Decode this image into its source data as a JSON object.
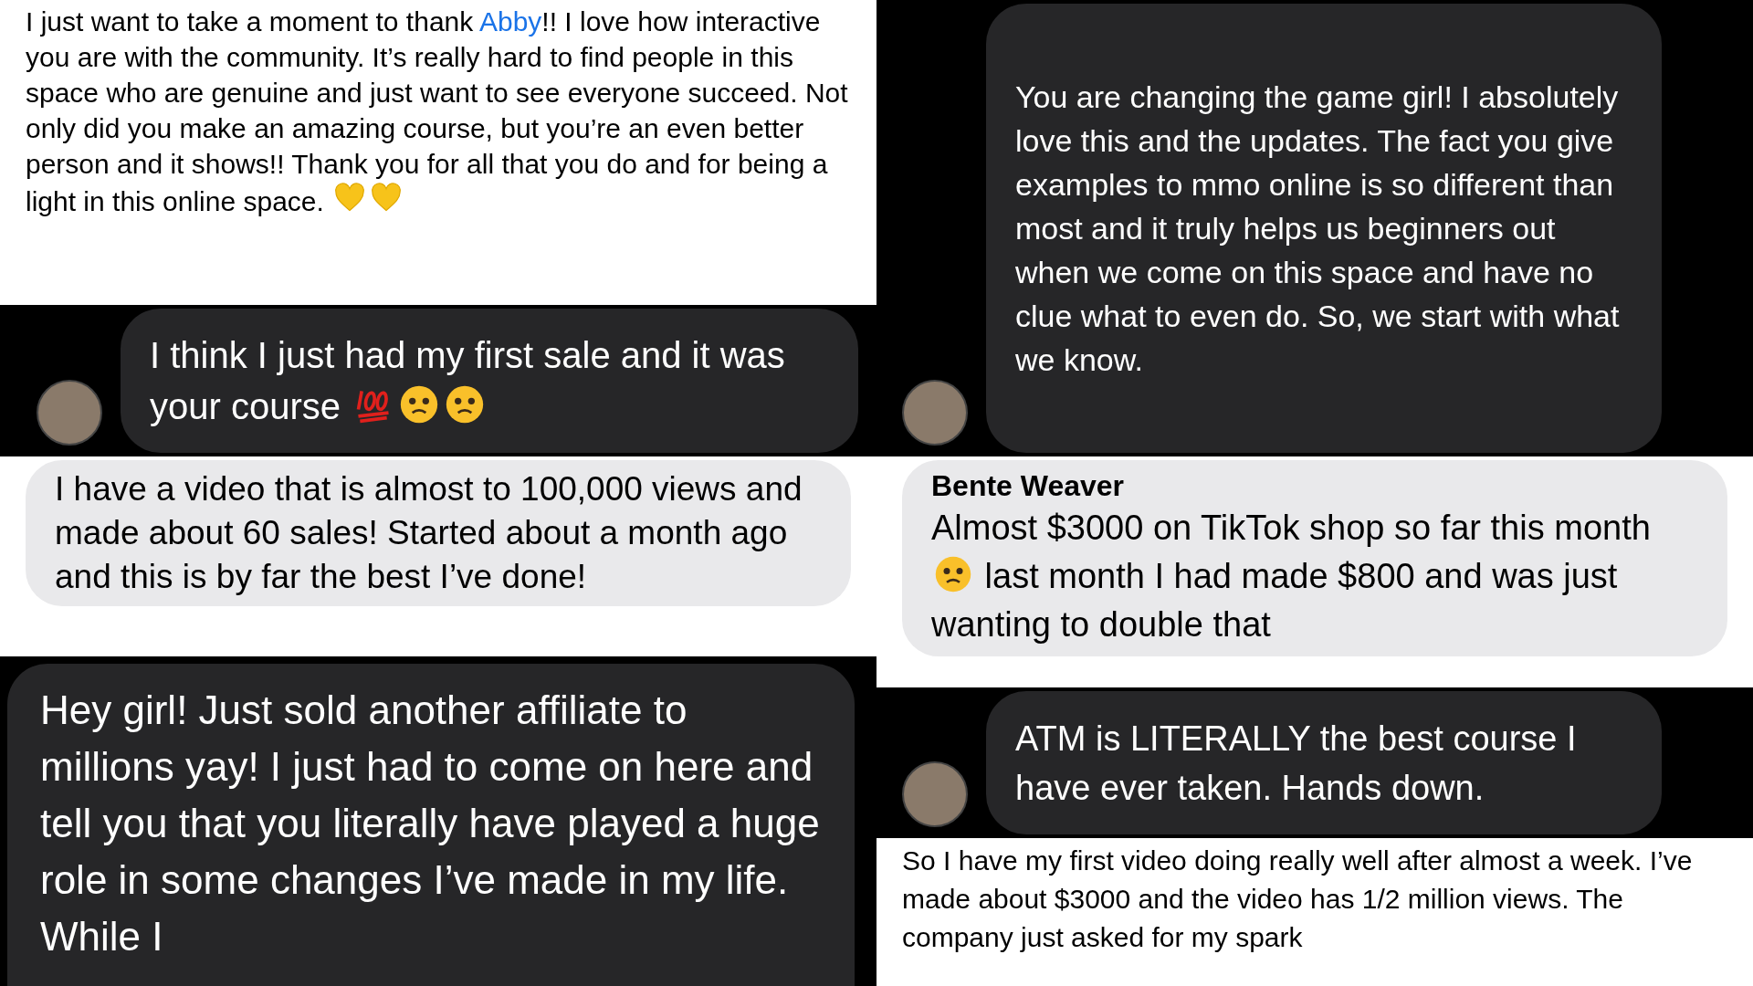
{
  "left": [
    {
      "kind": "plain",
      "segments": [
        {
          "kind": "text",
          "text": "I just want to take a moment to thank "
        },
        {
          "kind": "link",
          "text": "Abby"
        },
        {
          "kind": "text",
          "text": "!! I love how interactive you are with the community. It’s really hard to find people in this space who are genuine and just want to see everyone succeed. Not only did you make an amazing course, but you’re an even better person and it shows!! Thank you for all that you do and for being a light in this online space. "
        },
        {
          "kind": "heart"
        },
        {
          "kind": "heart"
        }
      ]
    },
    {
      "kind": "dark",
      "segments": [
        {
          "kind": "text",
          "text": "I think I just had my first sale and it was your course "
        },
        {
          "kind": "hundred"
        },
        {
          "kind": "face"
        },
        {
          "kind": "face"
        }
      ]
    },
    {
      "kind": "light",
      "segments": [
        {
          "kind": "text",
          "text": "I have a video that is almost to 100,000 views and made about 60 sales!  Started about a month ago and this is by far the best I’ve done!"
        }
      ]
    },
    {
      "kind": "big",
      "segments": [
        {
          "kind": "text",
          "text": "Hey girl! Just sold another affiliate to millions yay! I just had to come on here and tell you that you literally have played a huge role in some changes I’ve made in my life. While I"
        }
      ]
    }
  ],
  "right": [
    {
      "kind": "dark",
      "segments": [
        {
          "kind": "text",
          "text": "You are changing the game girl! I absolutely love this and the updates. The fact you give examples to mmo online is so different than most and it truly helps us beginners out when we come on this space and have no clue what to even do. So, we start with what we know."
        }
      ]
    },
    {
      "kind": "light",
      "sender": "Bente Weaver",
      "segments": [
        {
          "kind": "text",
          "text": "Almost $3000 on TikTok shop so far this month "
        },
        {
          "kind": "face"
        },
        {
          "kind": "text",
          "text": " last month I had made $800 and was just wanting to double that"
        }
      ]
    },
    {
      "kind": "dark",
      "segments": [
        {
          "kind": "text",
          "text": "ATM is LITERALLY the best course I have ever taken. Hands down."
        }
      ]
    },
    {
      "kind": "plain",
      "segments": [
        {
          "kind": "text",
          "text": "So I have my first video doing really well after almost a week. I’ve made about $3000 and the video has 1/2 million views. The company just asked for my spark"
        }
      ]
    }
  ]
}
